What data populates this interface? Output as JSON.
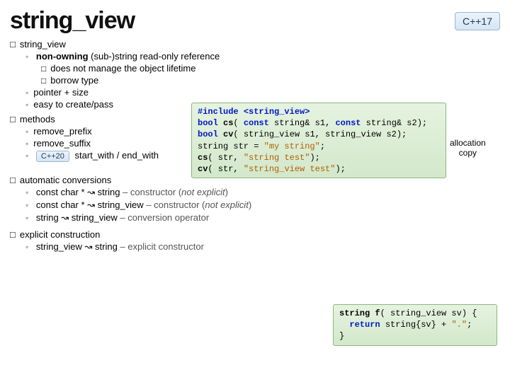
{
  "header": {
    "title": "string_view",
    "badge": "C++17"
  },
  "sec1": {
    "title": "string_view",
    "sub1_prefix": "non-owning",
    "sub1_rest": " (sub-)string read-only reference",
    "subsq1": "does not manage the object lifetime",
    "subsq2": "borrow type",
    "sub2": "pointer + size",
    "sub3": "easy to create/pass"
  },
  "sec2": {
    "title": "methods",
    "m1": "remove_prefix",
    "m2": "remove_suffix",
    "m3_badge": "C++20",
    "m3_text": " start_with / end_with"
  },
  "sec3": {
    "title": "automatic conversions",
    "c1_a": "const char * ↝ string",
    "c1_b": "  – constructor (",
    "c1_c": "not explicit",
    "c1_d": ")",
    "c2_a": "const char * ↝ string_view",
    "c2_b": "  – constructor (",
    "c2_c": "not explicit",
    "c2_d": ")",
    "c3_a": "string ↝ string_view",
    "c3_b": "  – conversion operator"
  },
  "sec4": {
    "title": "explicit construction",
    "e1_a": "string_view ↝ string",
    "e1_b": "  – explicit constructor"
  },
  "code1": {
    "l1a": "#include ",
    "l1b": "<string_view>",
    "l2a": "bool",
    "l2b": " cs",
    "l2c": "( ",
    "l2d": "const",
    "l2e": " string& s1, ",
    "l2f": "const",
    "l2g": " string& s2);",
    "l3a": "bool",
    "l3b": " cv",
    "l3c": "( string_view s1, string_view s2);",
    "l4a": "string str = ",
    "l4b": "\"my string\"",
    "l4c": ";",
    "l5a": "cs",
    "l5b": "( str, ",
    "l5c": "\"string test\"",
    "l5d": ");",
    "l6a": "cv",
    "l6b": "( str, ",
    "l6c": "\"string_view test\"",
    "l6d": ");"
  },
  "note1": {
    "l1": "allocation",
    "l2": "copy"
  },
  "code2": {
    "l1a": "string f",
    "l1b": "( string_view sv) {",
    "l2a": "  ",
    "l2b": "return",
    "l2c": " string{sv} + ",
    "l2d": "\".\"",
    "l2e": ";",
    "l3": "}"
  }
}
